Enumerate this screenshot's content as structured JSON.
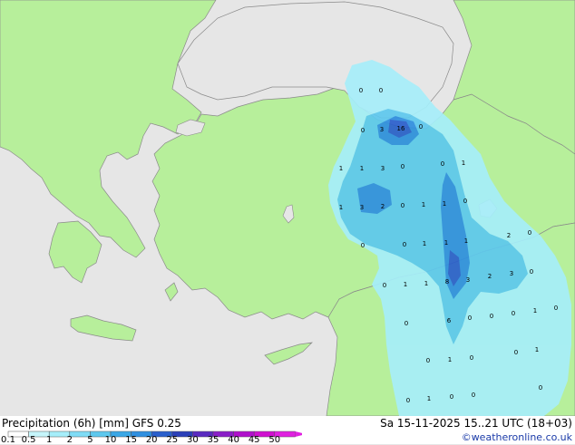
{
  "colors": {
    "sea": "#e6e6e6",
    "land": "#b7ef9b",
    "border": "#8a8a8a",
    "coast": "#8a8a8a",
    "precip_light": "#a6eefa",
    "precip_mid": "#5ec8ee",
    "precip_heavy": "#2f8fe0",
    "precip_max": "#2a5fcc"
  },
  "footer": {
    "legend_title": "Precipitation (6h) [mm] GFS 0.25",
    "run_time": "Sa 15-11-2025 15..21 UTC (18+03)",
    "credit": "©weatheronline.co.uk"
  },
  "legend": {
    "ticks": [
      "0.1",
      "0.5",
      "1",
      "2",
      "5",
      "10",
      "15",
      "20",
      "25",
      "30",
      "35",
      "40",
      "45",
      "50"
    ],
    "colors": [
      "#ffffff",
      "#c5f5fa",
      "#a6eefa",
      "#7fdcf6",
      "#5ec8ee",
      "#3aa7e6",
      "#2f8fe0",
      "#2a5fcc",
      "#2a3fb8",
      "#5a2ac0",
      "#8a1ec8",
      "#b010cc",
      "#d010d0",
      "#e020e0"
    ]
  },
  "map_values": [
    {
      "text": "0"
    },
    {
      "text": "0"
    },
    {
      "text": "0"
    },
    {
      "text": "3"
    },
    {
      "text": "16"
    },
    {
      "text": "0"
    },
    {
      "text": "1"
    },
    {
      "text": "1"
    },
    {
      "text": "3"
    },
    {
      "text": "0"
    },
    {
      "text": "0"
    },
    {
      "text": "1"
    },
    {
      "text": "1"
    },
    {
      "text": "3"
    },
    {
      "text": "2"
    },
    {
      "text": "0"
    },
    {
      "text": "1"
    },
    {
      "text": "1"
    },
    {
      "text": "0"
    },
    {
      "text": "0"
    },
    {
      "text": "0"
    },
    {
      "text": "1"
    },
    {
      "text": "1"
    },
    {
      "text": "1"
    },
    {
      "text": "2"
    },
    {
      "text": "0"
    },
    {
      "text": "0"
    },
    {
      "text": "1"
    },
    {
      "text": "1"
    },
    {
      "text": "8"
    },
    {
      "text": "3"
    },
    {
      "text": "2"
    },
    {
      "text": "3"
    },
    {
      "text": "0"
    },
    {
      "text": "6"
    },
    {
      "text": "0"
    },
    {
      "text": "0"
    },
    {
      "text": "0"
    },
    {
      "text": "1"
    },
    {
      "text": "0"
    },
    {
      "text": "0"
    },
    {
      "text": "0"
    },
    {
      "text": "1"
    },
    {
      "text": "0"
    },
    {
      "text": "1"
    },
    {
      "text": "0"
    },
    {
      "text": "0"
    },
    {
      "text": "1"
    },
    {
      "text": "0"
    },
    {
      "text": "0"
    },
    {
      "text": "0"
    }
  ]
}
